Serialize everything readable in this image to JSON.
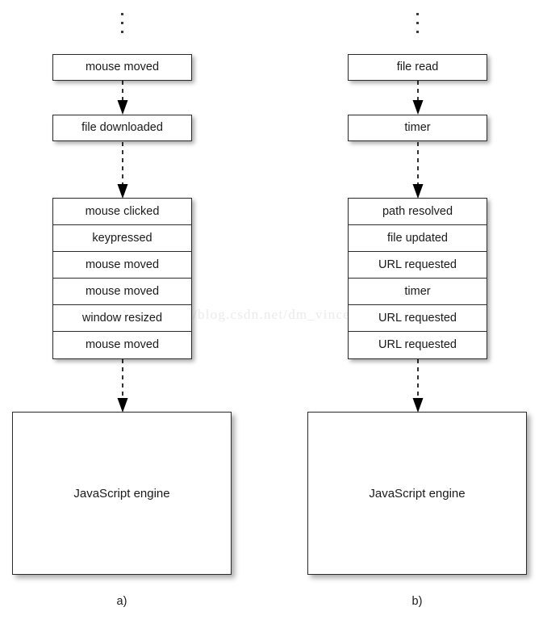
{
  "figure": {
    "watermark": "http://blog.csdn.net/dm_vincent",
    "panels": [
      {
        "id": "a",
        "caption": "a)",
        "ellipsis_icon": "vertical-ellipsis-icon",
        "top_events": [
          "mouse moved",
          "file downloaded"
        ],
        "queue_events": [
          "mouse clicked",
          "keypressed",
          "mouse moved",
          "mouse moved",
          "window resized",
          "mouse moved"
        ],
        "engine_label": "JavaScript engine"
      },
      {
        "id": "b",
        "caption": "b)",
        "ellipsis_icon": "vertical-ellipsis-icon",
        "top_events": [
          "file read",
          "timer"
        ],
        "queue_events": [
          "path resolved",
          "file updated",
          "URL requested",
          "timer",
          "URL requested",
          "URL requested"
        ],
        "engine_label": "JavaScript engine"
      }
    ]
  },
  "colors": {
    "background": "#ffffff",
    "box_border": "#2b2b2b",
    "box_fill": "#ffffff",
    "text": "#1a1a1a",
    "arrow": "#000000",
    "watermark": "#eceaea"
  }
}
